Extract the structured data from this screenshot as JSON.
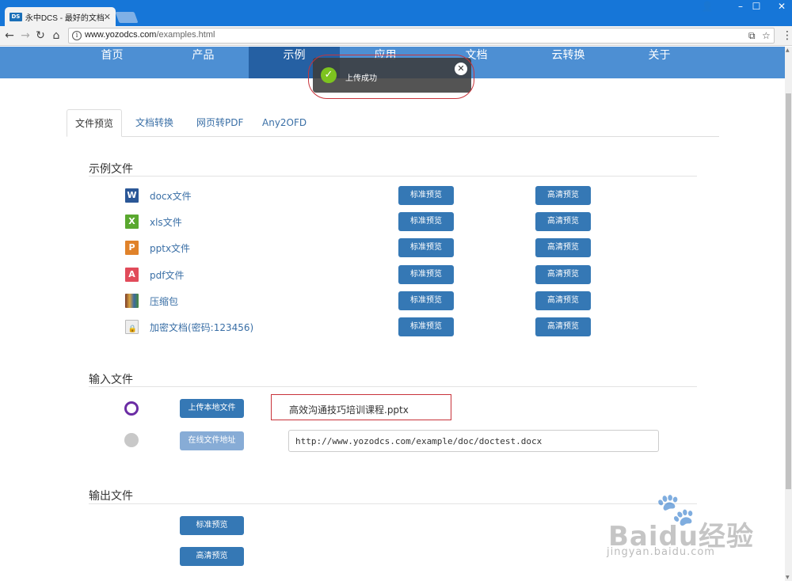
{
  "browser": {
    "tab_title": "永中DCS - 最好的文档在",
    "favicon_text": "DS",
    "url_host": "www.yozodcs.com",
    "url_path": "/examples.html"
  },
  "site_nav": {
    "items": [
      "首页",
      "产品",
      "示例",
      "应用",
      "文档",
      "云转换",
      "关于"
    ],
    "active": "示例"
  },
  "toast": {
    "message": "上传成功"
  },
  "tabs": [
    "文件预览",
    "文档转换",
    "网页转PDF",
    "Any2OFD"
  ],
  "sample_section": {
    "title": "示例文件",
    "files": [
      {
        "name": "docx文件",
        "icon": "word-icon",
        "color": "#2b5797"
      },
      {
        "name": "xls文件",
        "icon": "excel-icon",
        "color": "#5aa82f"
      },
      {
        "name": "pptx文件",
        "icon": "powerpoint-icon",
        "color": "#e0822a"
      },
      {
        "name": "pdf文件",
        "icon": "pdf-icon",
        "color": "#e14b5a"
      },
      {
        "name": "压缩包",
        "icon": "archive-icon",
        "color": "#5a4a3a"
      },
      {
        "name": "加密文档(密码:123456)",
        "icon": "encrypted-doc-icon",
        "color": "#dcdcdc"
      }
    ],
    "standard_label": "标准预览",
    "hd_label": "高清预览"
  },
  "input_section": {
    "title": "输入文件",
    "upload_label": "上传本地文件",
    "uploaded_file": "高效沟通技巧培训课程.pptx",
    "online_label": "在线文件地址",
    "online_url": "http://www.yozodcs.com/example/doc/doctest.docx"
  },
  "output_section": {
    "title": "输出文件",
    "standard_label": "标准预览",
    "hd_label": "高清预览"
  },
  "watermark": {
    "brand": "Baidu经验",
    "sub": "jingyan.baidu.com"
  },
  "colors": {
    "nav": "#4d8fd3",
    "nav_active": "#2560a3",
    "button": "#3578b5",
    "radio": "#6b2ca4",
    "highlight": "#c8333a"
  }
}
